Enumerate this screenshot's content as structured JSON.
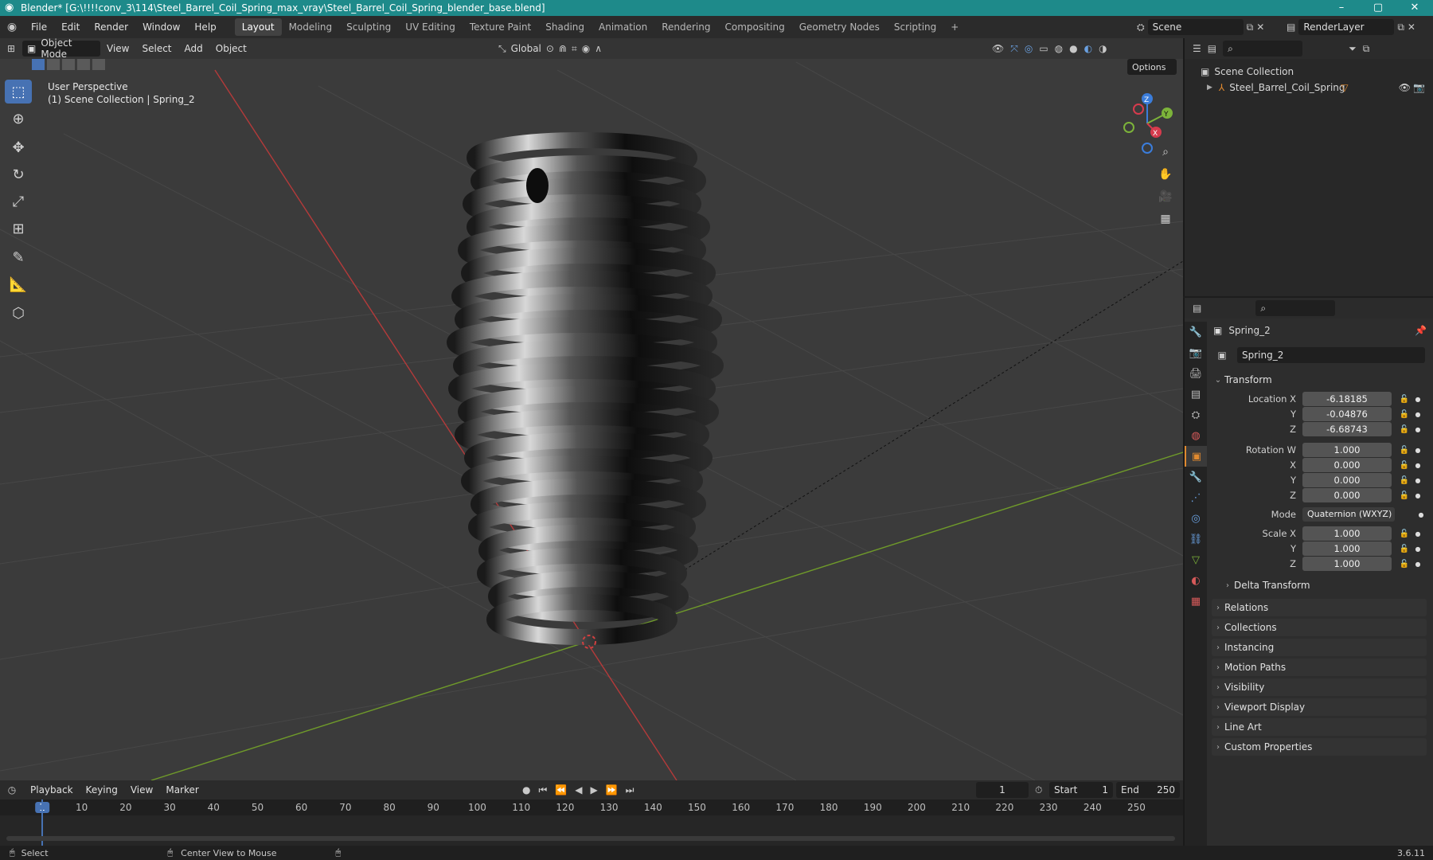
{
  "window": {
    "title": "Blender* [G:\\!!!!conv_3\\114\\Steel_Barrel_Coil_Spring_max_vray\\Steel_Barrel_Coil_Spring_blender_base.blend]"
  },
  "menu": {
    "items": [
      "File",
      "Edit",
      "Render",
      "Window",
      "Help"
    ]
  },
  "workspaces": [
    "Layout",
    "Modeling",
    "Sculpting",
    "UV Editing",
    "Texture Paint",
    "Shading",
    "Animation",
    "Rendering",
    "Compositing",
    "Geometry Nodes",
    "Scripting"
  ],
  "active_workspace": "Layout",
  "scene": {
    "name": "Scene",
    "render_layer": "RenderLayer"
  },
  "viewport": {
    "mode": "Object Mode",
    "menus": [
      "View",
      "Select",
      "Add",
      "Object"
    ],
    "orientation": "Global",
    "options_label": "Options",
    "perspective_label": "User Perspective",
    "collection_label": "(1) Scene Collection | Spring_2",
    "gizmo": {
      "x": "X",
      "y": "Y",
      "z": "Z"
    }
  },
  "outliner": {
    "root": "Scene Collection",
    "items": [
      {
        "label": "Steel_Barrel_Coil_Spring"
      }
    ]
  },
  "properties": {
    "object_name": "Spring_2",
    "datablock_name": "Spring_2",
    "transform_label": "Transform",
    "location": {
      "label": "Location X",
      "x": "-6.18185",
      "y": "-0.04876",
      "z": "-6.68743"
    },
    "rotation": {
      "label": "Rotation W",
      "w": "1.000",
      "x": "0.000",
      "y": "0.000",
      "z": "0.000"
    },
    "mode": {
      "label": "Mode",
      "value": "Quaternion (WXYZ)"
    },
    "scale": {
      "label": "Scale X",
      "x": "1.000",
      "y": "1.000",
      "z": "1.000"
    },
    "axis_labels": {
      "y": "Y",
      "z": "Z",
      "x": "X"
    },
    "delta_transform": "Delta Transform",
    "sections": [
      "Relations",
      "Collections",
      "Instancing",
      "Motion Paths",
      "Visibility",
      "Viewport Display",
      "Line Art",
      "Custom Properties"
    ]
  },
  "timeline": {
    "menus": [
      "Playback",
      "Keying",
      "View",
      "Marker"
    ],
    "current_frame": "1",
    "start_label": "Start",
    "start": "1",
    "end_label": "End",
    "end": "250",
    "ticks": [
      "1",
      "10",
      "20",
      "30",
      "40",
      "50",
      "60",
      "70",
      "80",
      "90",
      "100",
      "110",
      "120",
      "130",
      "140",
      "150",
      "160",
      "170",
      "180",
      "190",
      "200",
      "210",
      "220",
      "230",
      "240",
      "250"
    ]
  },
  "status": {
    "left": "Select",
    "middle": "Center View to Mouse",
    "version": "3.6.11"
  },
  "colors": {
    "accent": "#4772b3",
    "title_bar": "#1e8a8a",
    "active_tab": "#e08a2f"
  }
}
